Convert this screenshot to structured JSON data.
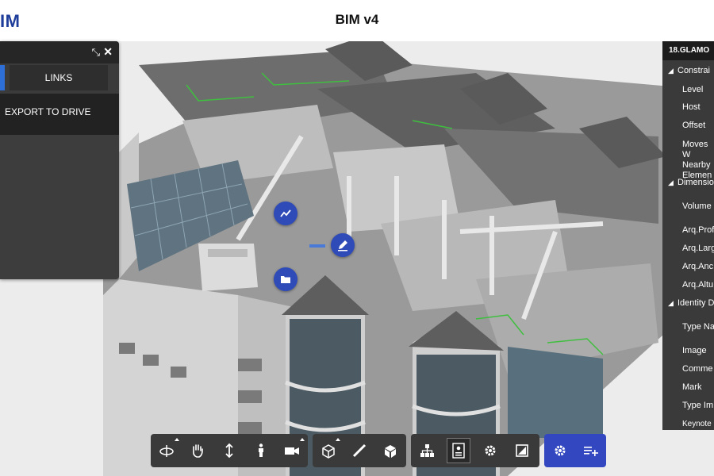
{
  "header": {
    "logo_text": "IM",
    "title": "BIM v4"
  },
  "left_panel": {
    "collapse_icon": "collapse-arrows-icon",
    "close_icon": "close-icon",
    "tab_links": "LINKS",
    "export_label": "EXPORT TO DRIVE"
  },
  "right_panel": {
    "title": "18.GLAMO",
    "sections": [
      {
        "label": "Constrai"
      },
      {
        "label": "Dimensio"
      },
      {
        "label": "Identity D"
      }
    ],
    "items": {
      "level": "Level",
      "host": "Host",
      "offset": "Offset",
      "moves": "Moves W Nearby Elemen",
      "volume": "Volume",
      "arq_prof": "Arq.Prof",
      "arq_larg": "Arq.Larg",
      "arq_anc": "Arq.Anc",
      "arq_alt": "Arq.Altu",
      "type_name": "Type Na",
      "image": "Image",
      "comments": "Comme",
      "mark": "Mark",
      "type_image": "Type Im",
      "keynote": "Keynote"
    }
  },
  "markers": {
    "chart_icon": "trend-chart-icon",
    "edit_icon": "pencil-icon",
    "folder_icon": "folder-icon"
  },
  "toolbar": {
    "group1": [
      "orbit-icon",
      "pan-hand-icon",
      "zoom-vertical-icon",
      "first-person-icon",
      "camera-icon"
    ],
    "group2": [
      "section-box-icon",
      "measure-ruler-icon",
      "explode-cube-icon"
    ],
    "group3": [
      "model-tree-icon",
      "properties-icon",
      "settings-gear-icon",
      "fullscreen-icon"
    ],
    "group4": [
      "settings-icon",
      "add-list-icon"
    ]
  },
  "colors": {
    "accent_blue": "#2f4bb8",
    "panel_dark": "#3a3a3a",
    "highlight_green": "#3fbf3f"
  }
}
